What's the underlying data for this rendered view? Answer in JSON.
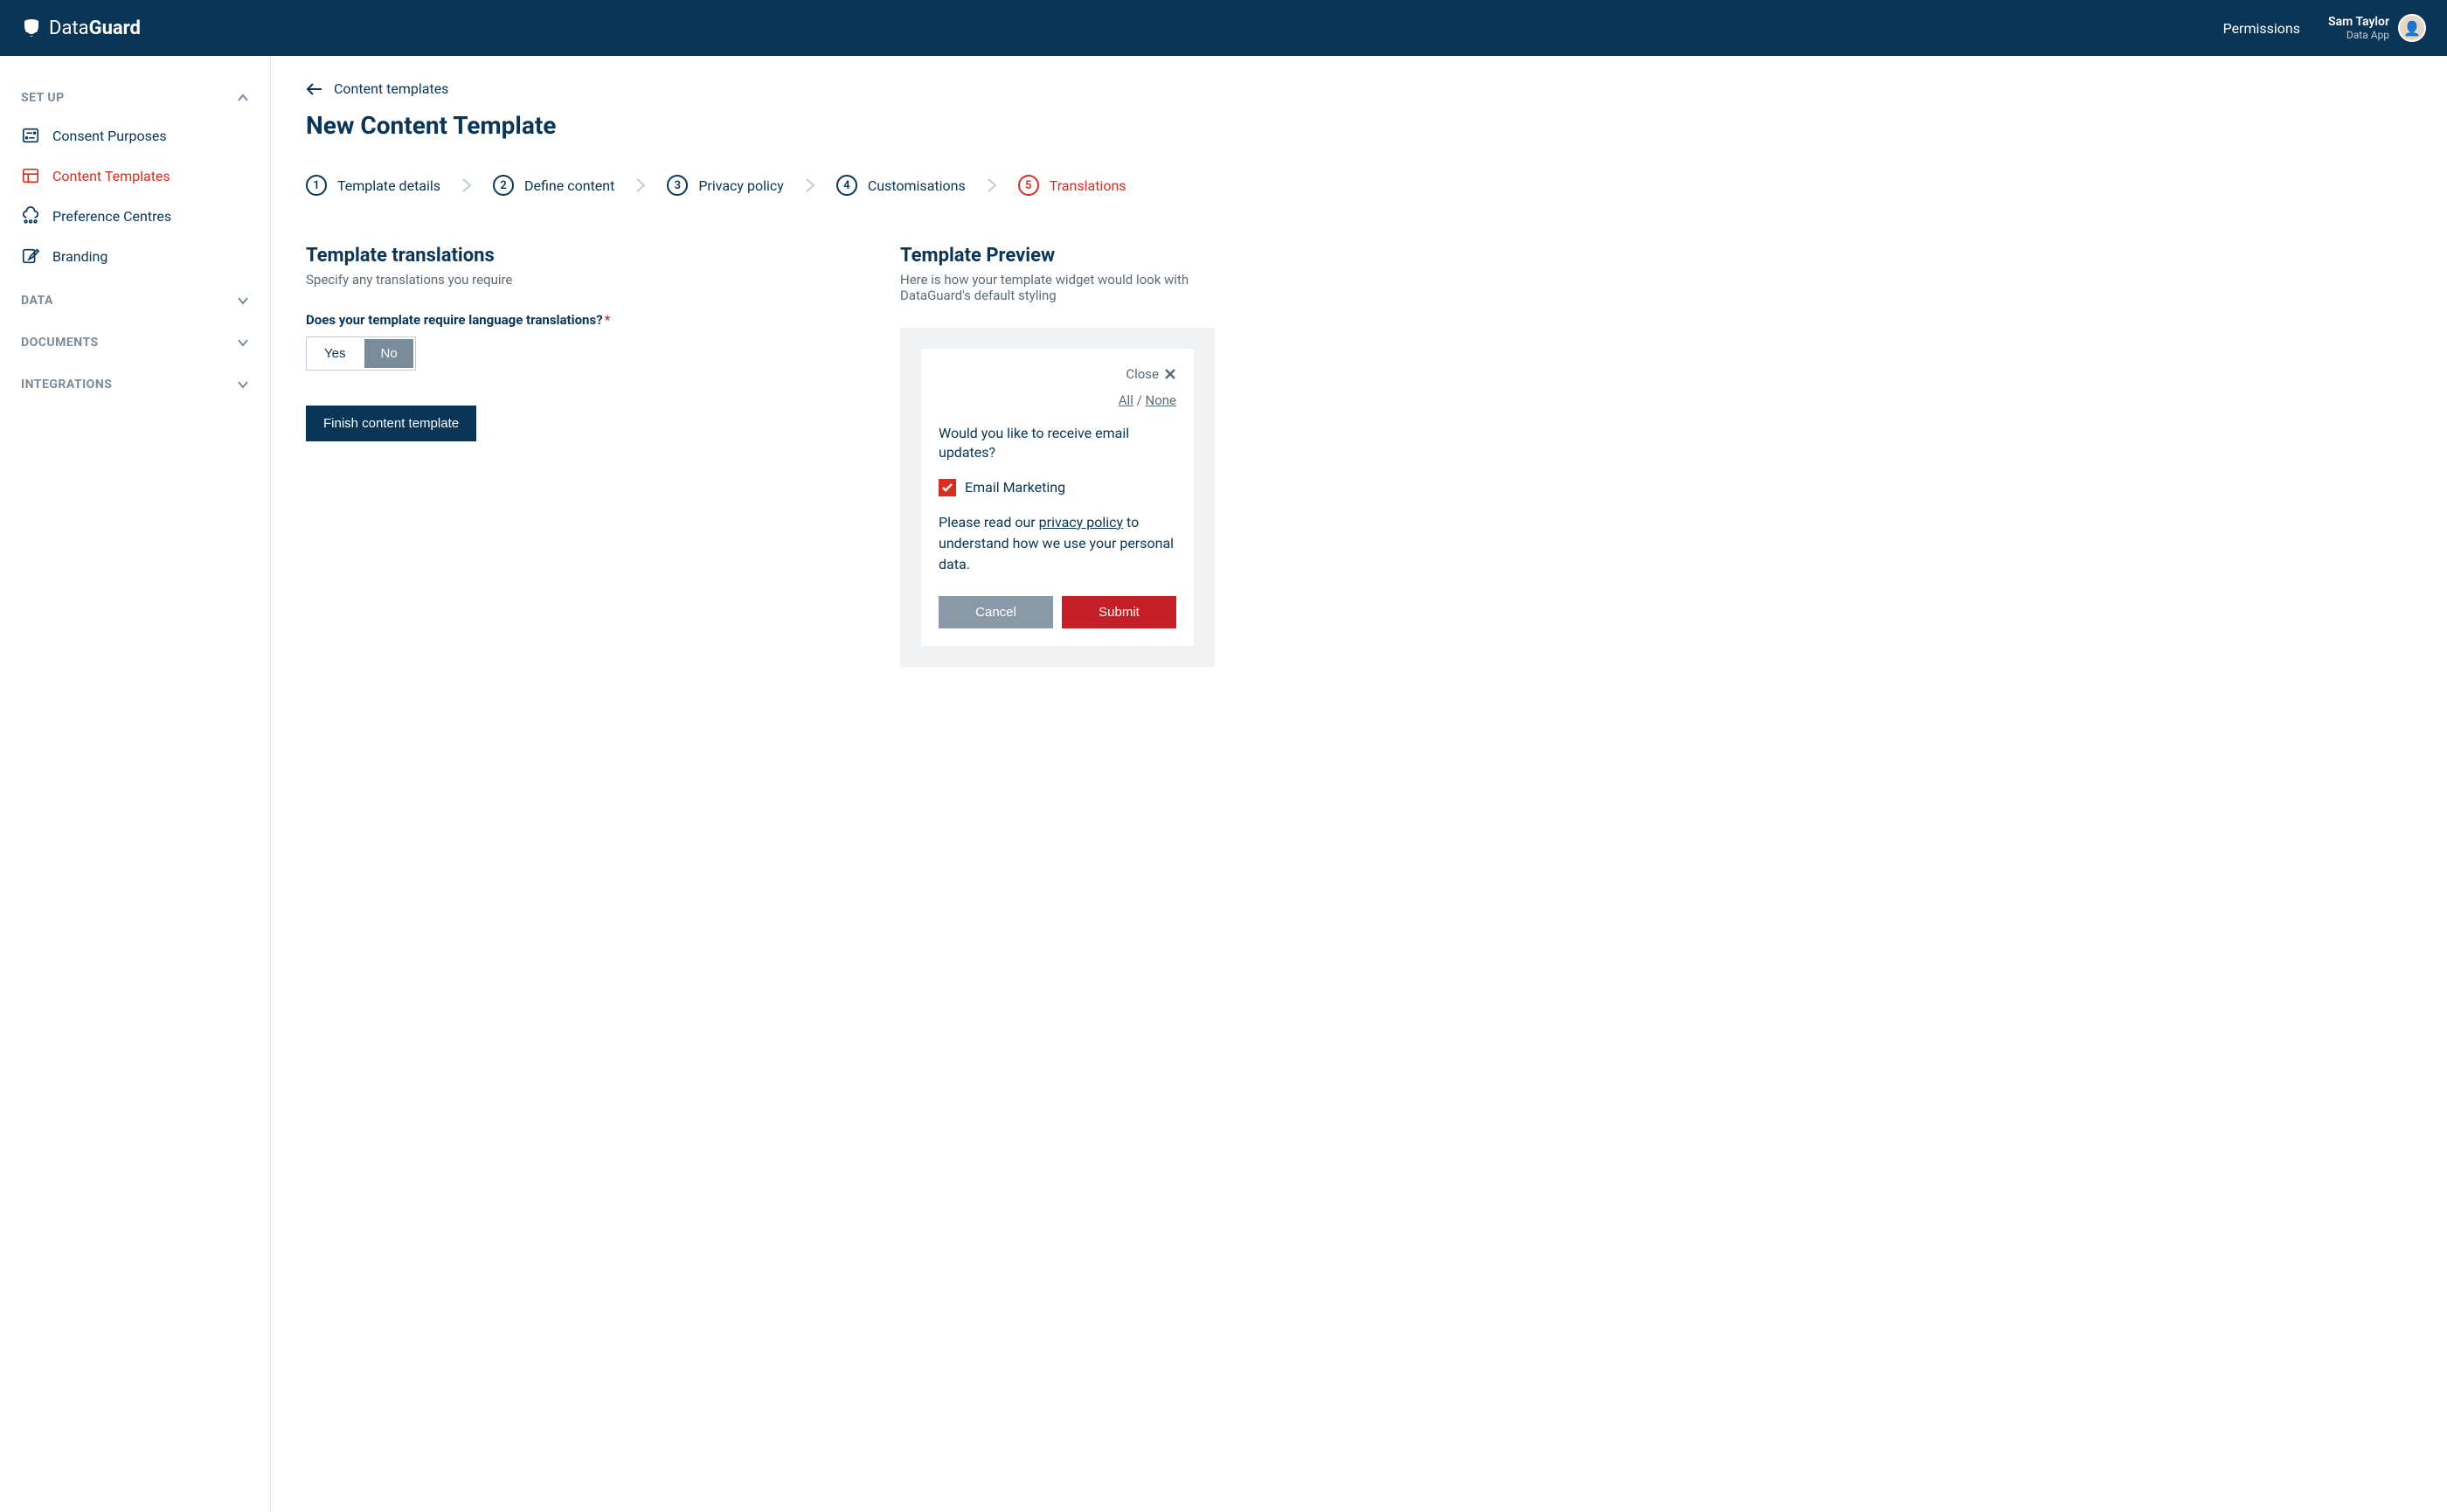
{
  "header": {
    "brand_prefix": "Data",
    "brand_suffix": "Guard",
    "permissions_label": "Permissions",
    "user_name": "Sam Taylor",
    "user_app": "Data App"
  },
  "sidebar": {
    "sections": [
      {
        "label": "SET UP",
        "expanded": true,
        "items": [
          {
            "label": "Consent Purposes",
            "active": false
          },
          {
            "label": "Content Templates",
            "active": true
          },
          {
            "label": "Preference Centres",
            "active": false
          },
          {
            "label": "Branding",
            "active": false
          }
        ]
      },
      {
        "label": "DATA",
        "expanded": false
      },
      {
        "label": "DOCUMENTS",
        "expanded": false
      },
      {
        "label": "INTEGRATIONS",
        "expanded": false
      }
    ]
  },
  "breadcrumb": {
    "back_label": "Content templates"
  },
  "page": {
    "title": "New Content Template"
  },
  "stepper": [
    {
      "num": "1",
      "label": "Template details",
      "active": false
    },
    {
      "num": "2",
      "label": "Define content",
      "active": false
    },
    {
      "num": "3",
      "label": "Privacy policy",
      "active": false
    },
    {
      "num": "4",
      "label": "Customisations",
      "active": false
    },
    {
      "num": "5",
      "label": "Translations",
      "active": true
    }
  ],
  "translations": {
    "title": "Template translations",
    "subtitle": "Specify any translations you require",
    "question": "Does your template require language translations?",
    "option_yes": "Yes",
    "option_no": "No",
    "selected": "No",
    "submit_label": "Finish content template"
  },
  "preview": {
    "title": "Template Preview",
    "subtitle": "Here is how your template widget would look with DataGuard's default styling",
    "widget": {
      "close_label": "Close",
      "all_label": "All",
      "sep": " / ",
      "none_label": "None",
      "question": "Would you like to receive email updates?",
      "checkbox_label": "Email Marketing",
      "checkbox_checked": true,
      "policy_pre": "Please read our ",
      "policy_link": "privacy policy",
      "policy_post": " to understand how we use your personal data.",
      "cancel_label": "Cancel",
      "submit_label": "Submit"
    }
  }
}
